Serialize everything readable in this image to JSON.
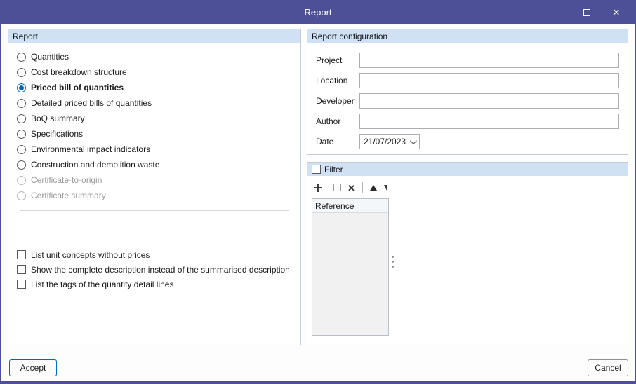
{
  "window": {
    "title": "Report",
    "icons": {
      "maximize": "square-outline",
      "close": "✕"
    }
  },
  "report_group": {
    "title": "Report",
    "options": [
      {
        "label": "Quantities",
        "state": "unselected"
      },
      {
        "label": "Cost breakdown structure",
        "state": "unselected"
      },
      {
        "label": "Priced bill of quantities",
        "state": "selected"
      },
      {
        "label": "Detailed priced bills of quantities",
        "state": "unselected"
      },
      {
        "label": "BoQ summary",
        "state": "unselected"
      },
      {
        "label": "Specifications",
        "state": "unselected"
      },
      {
        "label": "Environmental impact indicators",
        "state": "unselected"
      },
      {
        "label": "Construction and demolition waste",
        "state": "unselected"
      },
      {
        "label": "Certificate-to-origin",
        "state": "disabled"
      },
      {
        "label": "Certificate summary",
        "state": "disabled"
      }
    ],
    "checkboxes": [
      {
        "label": "List unit concepts without prices",
        "checked": false
      },
      {
        "label": "Show the complete description instead of the summarised description",
        "checked": false
      },
      {
        "label": "List the tags of the quantity detail lines",
        "checked": false
      }
    ]
  },
  "config_group": {
    "title": "Report configuration",
    "fields": [
      {
        "label": "Project",
        "value": ""
      },
      {
        "label": "Location",
        "value": ""
      },
      {
        "label": "Developer",
        "value": ""
      },
      {
        "label": "Author",
        "value": ""
      }
    ],
    "date_field": {
      "label": "Date",
      "value": "21/07/2023"
    }
  },
  "filter_group": {
    "title": "Filter",
    "checked": false,
    "toolbar": {
      "add": "plus-shape",
      "duplicate": "overlapping-squares-shape",
      "delete": "✕",
      "move_up": "up-triangle-shape"
    },
    "list_header": "Reference"
  },
  "footer": {
    "accept_label": "Accept",
    "cancel_label": "Cancel"
  },
  "colors": {
    "titlebar": "#4d5096",
    "header_strip": "#cfe1f3",
    "accent": "#0067c0"
  }
}
